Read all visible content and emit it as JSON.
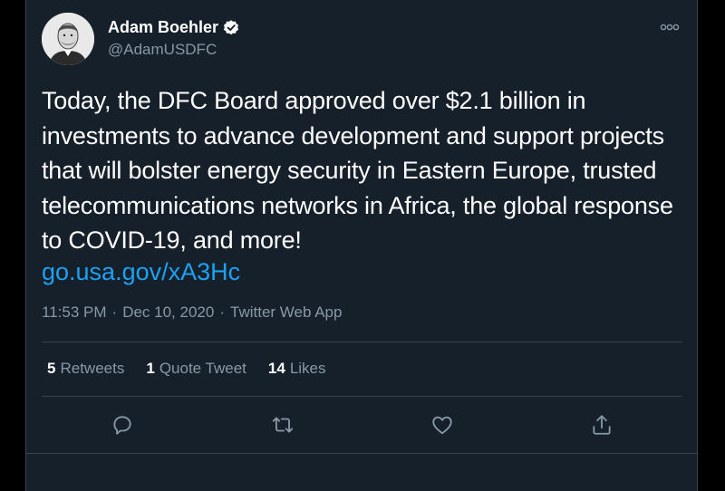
{
  "author": {
    "name": "Adam Boehler",
    "handle": "@AdamUSDFC",
    "verified": true,
    "avatar_icon": "profile-photo"
  },
  "tweet": {
    "text": "Today, the DFC Board approved over $2.1 billion in investments to advance development and support projects that will bolster energy security in Eastern Europe, trusted telecommunications networks in Africa, the global response to COVID-19, and more!",
    "link": "go.usa.gov/xA3Hc"
  },
  "meta": {
    "time": "11:53 PM",
    "separator1": "·",
    "date": "Dec 10, 2020",
    "separator2": "·",
    "source": "Twitter Web App"
  },
  "stats": {
    "retweets_count": "5",
    "retweets_label": "Retweets",
    "quotes_count": "1",
    "quotes_label": "Quote Tweet",
    "likes_count": "14",
    "likes_label": "Likes"
  },
  "actions": [
    {
      "name": "reply-icon"
    },
    {
      "name": "retweet-icon"
    },
    {
      "name": "like-icon"
    },
    {
      "name": "share-icon"
    }
  ],
  "colors": {
    "background": "#15202b",
    "text": "#ffffff",
    "secondary": "#8899a6",
    "link": "#1da1f2",
    "border": "#38444d"
  }
}
